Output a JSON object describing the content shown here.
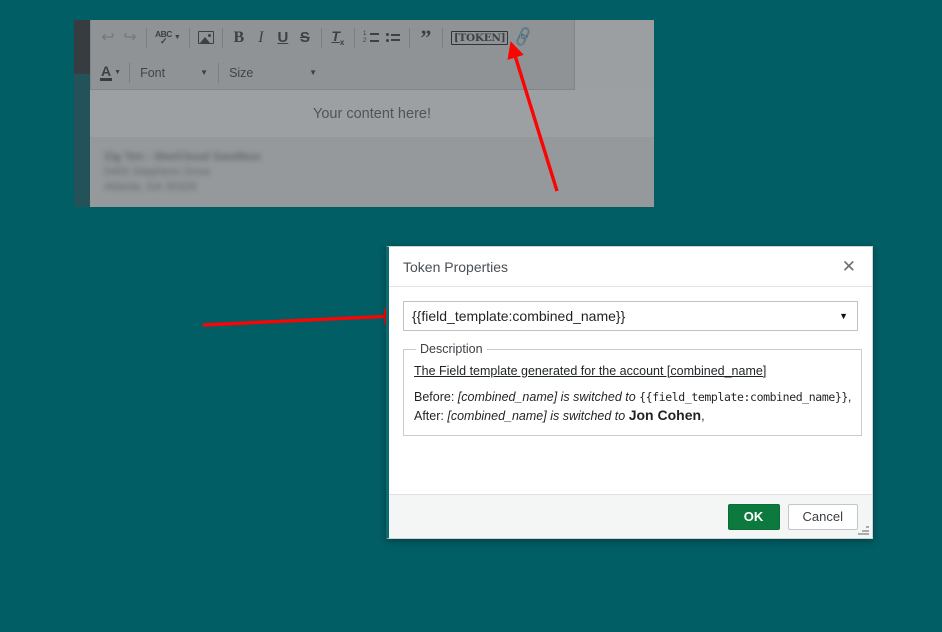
{
  "background_editor": {
    "toolbar": {
      "row1": [
        {
          "name": "undo-icon",
          "label": "↩",
          "kind": "icon",
          "disabled": true
        },
        {
          "name": "redo-icon",
          "label": "↪",
          "kind": "icon",
          "disabled": true
        },
        {
          "name": "separator",
          "kind": "sep"
        },
        {
          "name": "spell-check-icon",
          "label": "ABC",
          "kind": "abc",
          "caret": true
        },
        {
          "name": "separator",
          "kind": "sep"
        },
        {
          "name": "image-icon",
          "label": "Image",
          "kind": "image"
        },
        {
          "name": "separator",
          "kind": "sep"
        },
        {
          "name": "bold-icon",
          "label": "B",
          "kind": "bold"
        },
        {
          "name": "italic-icon",
          "label": "I",
          "kind": "italic"
        },
        {
          "name": "underline-icon",
          "label": "U",
          "kind": "underline"
        },
        {
          "name": "strikethrough-icon",
          "label": "S",
          "kind": "strike"
        },
        {
          "name": "separator",
          "kind": "sep"
        },
        {
          "name": "remove-format-icon",
          "label": "T",
          "sub": "x",
          "kind": "tx"
        },
        {
          "name": "separator",
          "kind": "sep"
        },
        {
          "name": "numbered-list-icon",
          "kind": "numlist"
        },
        {
          "name": "bulleted-list-icon",
          "kind": "bullist"
        },
        {
          "name": "separator",
          "kind": "sep"
        },
        {
          "name": "blockquote-icon",
          "label": "”",
          "kind": "quote"
        },
        {
          "name": "separator",
          "kind": "sep"
        },
        {
          "name": "token-icon",
          "label": "[TOKEN]",
          "kind": "token"
        },
        {
          "name": "link-icon",
          "label": "🔗",
          "kind": "link"
        }
      ],
      "row2": {
        "text_color_label": "A",
        "font_label": "Font",
        "size_label": "Size"
      }
    },
    "content_placeholder": "Your content here!",
    "signature_lines": [
      "Zig Ten - SkeiCloud Sandbox",
      "5455 Stephens Drive",
      "Atlanta, GA 30328"
    ]
  },
  "dialog": {
    "title": "Token Properties",
    "close_label": "✕",
    "token_value": "{{field_template:combined_name}}",
    "dropdown_arrow": "▼",
    "description_legend": "Description",
    "description_headline": "The Field template generated for the account [combined_name]",
    "before": {
      "label": "Before:",
      "phrase": "[combined_name] is switched to",
      "value": "{{field_template:combined_name}}",
      "trailing": ","
    },
    "after": {
      "label": "After:",
      "phrase": "[combined_name] is switched to",
      "value": "Jon Cohen",
      "trailing": ","
    },
    "ok_label": "OK",
    "cancel_label": "Cancel"
  },
  "colors": {
    "page_background": "#005e64",
    "dialog_accent": "#0c6a71",
    "ok_button": "#0c7a3e",
    "annotation_arrow": "#fb0404"
  }
}
